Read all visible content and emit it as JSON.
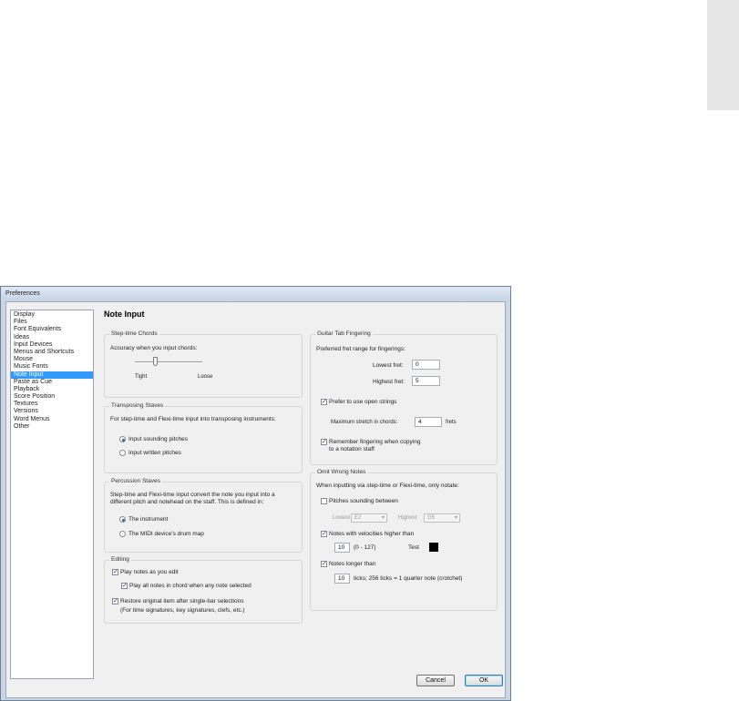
{
  "window": {
    "title": "Preferences"
  },
  "categories": [
    {
      "label": "Display",
      "selected": false
    },
    {
      "label": "Files",
      "selected": false
    },
    {
      "label": "Font Equivalents",
      "selected": false
    },
    {
      "label": "Ideas",
      "selected": false
    },
    {
      "label": "Input Devices",
      "selected": false
    },
    {
      "label": "Menus and Shortcuts",
      "selected": false
    },
    {
      "label": "Mouse",
      "selected": false
    },
    {
      "label": "Music Fonts",
      "selected": false
    },
    {
      "label": "Note Input",
      "selected": true
    },
    {
      "label": "Paste as Cue",
      "selected": false
    },
    {
      "label": "Playback",
      "selected": false
    },
    {
      "label": "Score Position",
      "selected": false
    },
    {
      "label": "Textures",
      "selected": false
    },
    {
      "label": "Versions",
      "selected": false
    },
    {
      "label": "Word Menus",
      "selected": false
    },
    {
      "label": "Other",
      "selected": false
    }
  ],
  "page_title": "Note Input",
  "step_time_chords": {
    "title": "Step-time Chords",
    "accuracy_label": "Accuracy when you input chords:",
    "tight_label": "Tight",
    "loose_label": "Loose",
    "accuracy_level": 0.3
  },
  "transposing_staves": {
    "title": "Transposing Staves",
    "description": "For step-time and Flexi-time input into transposing instruments:",
    "opt_sounding": "Input sounding pitches",
    "opt_written": "Input written pitches",
    "selected": "sounding"
  },
  "percussion_staves": {
    "title": "Percussion Staves",
    "description_1": "Step-time and Flexi-time input convert the note you input into a",
    "description_2": "different pitch and notehead on the staff. This is defined in:",
    "opt_instrument": "The instrument",
    "opt_drum_map": "The MIDI device's drum map",
    "selected": "instrument"
  },
  "editing": {
    "title": "Editing",
    "play_notes_label": "Play notes as you edit",
    "play_notes_checked": true,
    "play_all_label": "Play all notes in chord when any note selected",
    "play_all_checked": true,
    "restore_label": "Restore original item after single-bar selections",
    "restore_note": "(For time signatures, key signatures, clefs, etc.)",
    "restore_checked": true
  },
  "guitar_tab": {
    "title": "Guitar Tab Fingering",
    "preferred_label": "Preferred fret range for fingerings:",
    "lowest_label": "Lowest fret:",
    "lowest_value": "0",
    "highest_label": "Highest fret:",
    "highest_value": "5",
    "open_strings_label": "Prefer to use open strings",
    "open_strings_checked": true,
    "stretch_label": "Maximum stretch in chords:",
    "stretch_value": "4",
    "stretch_unit": "frets",
    "remember_label_1": "Remember fingering when copying",
    "remember_label_2": "to a notation staff",
    "remember_checked": true
  },
  "omit_wrong": {
    "title": "Omit Wrong Notes",
    "description": "When inputting via step-time or Flexi-time, only notate:",
    "pitches_label": "Pitches sounding between",
    "pitches_checked": false,
    "lowest_label": "Lowest",
    "lowest_value": "E2",
    "highest_label": "Highest",
    "highest_value": "G5",
    "velocity_label": "Notes with velocities higher than",
    "velocity_checked": true,
    "velocity_value": "10",
    "velocity_range": "(0 - 127)",
    "test_label": "Test",
    "longer_label": "Notes longer than",
    "longer_checked": true,
    "longer_value": "10",
    "ticks_label": "ticks; 256 ticks = 1 quarter note (crotchet)"
  },
  "buttons": {
    "cancel": "Cancel",
    "ok": "OK"
  }
}
